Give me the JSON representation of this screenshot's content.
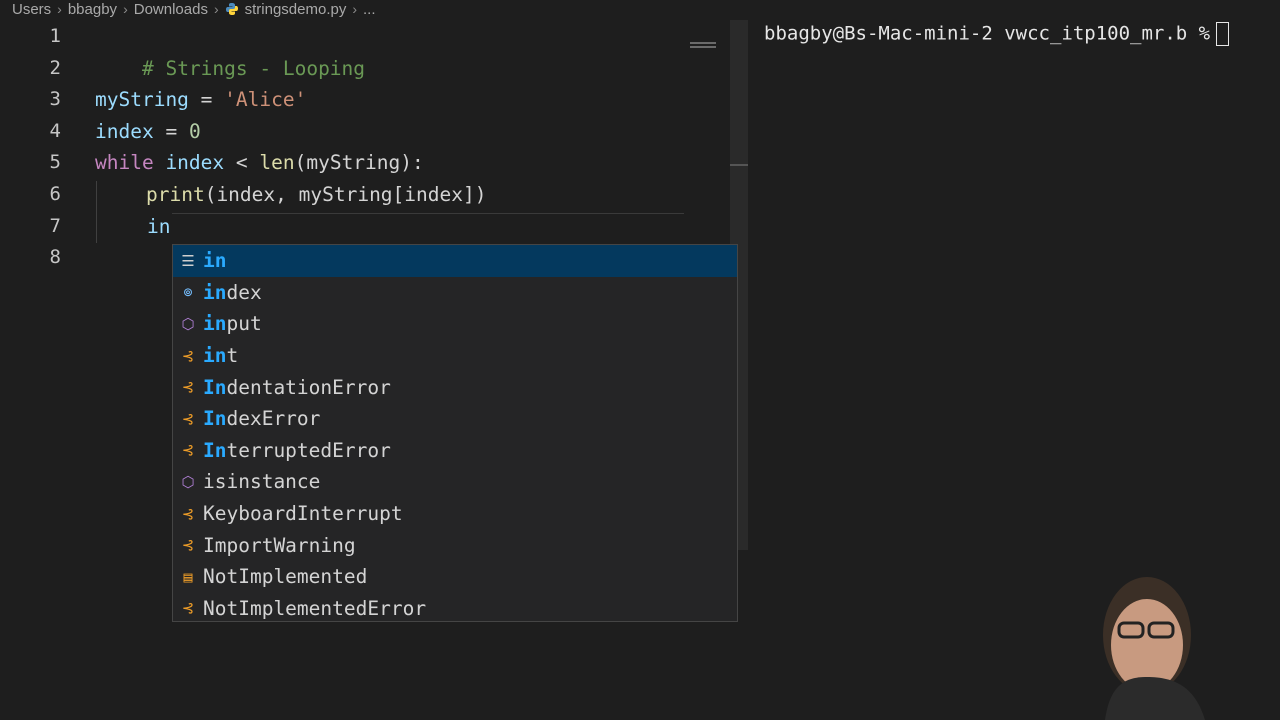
{
  "breadcrumb": {
    "items": [
      "Users",
      "bbagby",
      "Downloads",
      "stringsdemo.py",
      "..."
    ]
  },
  "editor": {
    "line_numbers": [
      "1",
      "2",
      "3",
      "4",
      "5",
      "6",
      "7",
      "8"
    ],
    "lines": {
      "l1": "# Strings - Looping",
      "l3_var": "myString",
      "l3_op": " = ",
      "l3_str": "'Alice'",
      "l4_var": "index",
      "l4_op": " = ",
      "l4_num": "0",
      "l5_kw": "while",
      "l5_var1": " index ",
      "l5_op": "< ",
      "l5_fn": "len",
      "l5_rest": "(myString):",
      "l6_fn": "print",
      "l6_rest": "(index, myString[index])",
      "l7_typed": "in"
    }
  },
  "suggestions": [
    {
      "icon": "keyword-icon",
      "match": "in",
      "rest": "",
      "selected": true
    },
    {
      "icon": "variable-icon",
      "match": "in",
      "rest": "dex"
    },
    {
      "icon": "function-icon",
      "match": "in",
      "rest": "put"
    },
    {
      "icon": "class-icon",
      "match": "in",
      "rest": "t"
    },
    {
      "icon": "class-icon",
      "match": "In",
      "rest": "dentationError"
    },
    {
      "icon": "class-icon",
      "match": "In",
      "rest": "dexError"
    },
    {
      "icon": "class-icon",
      "match": "In",
      "rest": "terruptedError"
    },
    {
      "icon": "function-icon",
      "label": "isinstance"
    },
    {
      "icon": "class-icon",
      "label": "KeyboardInterrupt"
    },
    {
      "icon": "class-icon",
      "label": "ImportWarning"
    },
    {
      "icon": "constant-icon",
      "label": "NotImplemented"
    },
    {
      "icon": "class-icon",
      "label": "NotImplementedError"
    }
  ],
  "terminal": {
    "prompt": "bbagby@Bs-Mac-mini-2 vwcc_itp100_mr.b %"
  },
  "colors": {
    "selection": "#04395e",
    "match_highlight": "#2aaaff",
    "class_icon": "#ee9d28",
    "function_icon": "#b180d7"
  }
}
